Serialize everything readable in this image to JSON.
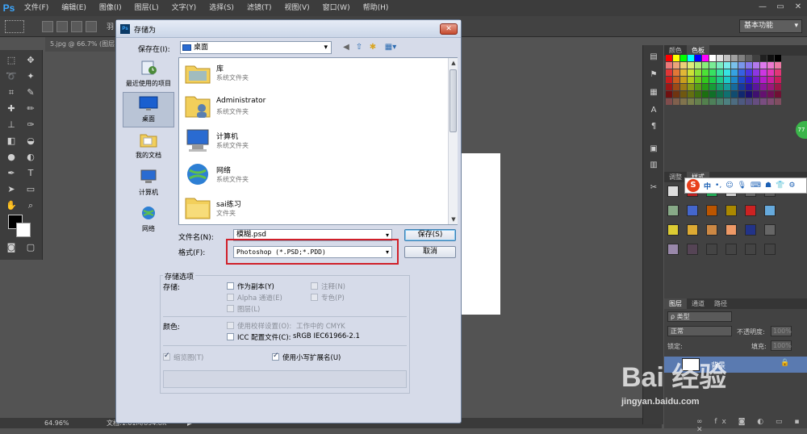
{
  "app": {
    "logo": "Ps"
  },
  "menu": [
    "文件(F)",
    "编辑(E)",
    "图像(I)",
    "图层(L)",
    "文字(Y)",
    "选择(S)",
    "滤镜(T)",
    "视图(V)",
    "窗口(W)",
    "帮助(H)"
  ],
  "window_controls": [
    "—",
    "▭",
    "✕"
  ],
  "options_bar": {
    "label": "羽",
    "workspace": "基本功能"
  },
  "document": {
    "tab": "5.jpg @ 66.7% (图层",
    "zoom": "64.96%",
    "doc_info": "文档:1.01M/894.8K"
  },
  "panels": {
    "swatch_tabs": [
      "颜色",
      "色板"
    ],
    "style_tabs": [
      "调整",
      "样式"
    ],
    "layer_tabs": [
      "图层",
      "通道",
      "路径"
    ],
    "layer_kind": "ρ 类型",
    "blend_mode": "正常",
    "opacity_label": "不透明度:",
    "opacity_value": "100%",
    "lock_label": "锁定:",
    "fill_label": "填充:",
    "fill_value": "100%",
    "layer_name": "背景"
  },
  "dialog": {
    "title": "存储为",
    "icon": "Ps",
    "save_in_label": "保存在(I):",
    "save_in_value": "桌面",
    "places": [
      {
        "label": "最近使用的项目",
        "icon": "recent-icon"
      },
      {
        "label": "桌面",
        "icon": "desktop-icon"
      },
      {
        "label": "我的文档",
        "icon": "documents-icon"
      },
      {
        "label": "计算机",
        "icon": "computer-icon"
      },
      {
        "label": "网络",
        "icon": "network-icon"
      }
    ],
    "files": [
      {
        "name": "库",
        "type": "系统文件夹",
        "icon": "library-icon"
      },
      {
        "name": "Administrator",
        "type": "系统文件夹",
        "icon": "user-folder-icon"
      },
      {
        "name": "计算机",
        "type": "系统文件夹",
        "icon": "computer-icon"
      },
      {
        "name": "网络",
        "type": "系统文件夹",
        "icon": "network-icon"
      },
      {
        "name": "sai练习",
        "type": "文件夹",
        "icon": "folder-icon"
      }
    ],
    "filename_label": "文件名(N):",
    "filename_value": "模糊.psd",
    "format_label": "格式(F):",
    "format_value": "Photoshop (*.PSD;*.PDD)",
    "save_button": "保存(S)",
    "cancel_button": "取消",
    "options_title": "存储选项",
    "store_label": "存储:",
    "as_copy": "作为副本(Y)",
    "notes": "注释(N)",
    "alpha": "Alpha 通道(E)",
    "spot": "专色(P)",
    "layers": "图层(L)",
    "color_label": "颜色:",
    "proof": "使用校样设置(O):",
    "proof_value": "工作中的 CMYK",
    "icc": "ICC 配置文件(C):",
    "icc_value": "sRGB IEC61966-2.1",
    "thumbnail": "缩览图(T)",
    "lowercase_ext": "使用小写扩展名(U)"
  },
  "watermark": {
    "main": "Bai 经验",
    "sub": "jingyan.baidu.com"
  },
  "ime": {
    "logo": "S",
    "lang": "中"
  }
}
